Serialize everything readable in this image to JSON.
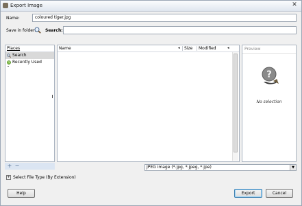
{
  "window": {
    "title": "Export Image",
    "close_symbol": "✕"
  },
  "form": {
    "name_label": "Name:",
    "name_value": "coloured tiger.jpg",
    "save_in_folder_label": "Save in folder:",
    "search_label": "Search:",
    "search_value": ""
  },
  "places": {
    "header": "Places",
    "items": [
      {
        "label": "Search",
        "icon": "magnifier-icon",
        "selected": true
      },
      {
        "label": "Recently Used",
        "icon": "clock-icon",
        "selected": false
      }
    ],
    "add_symbol": "+",
    "remove_symbol": "−"
  },
  "file_list": {
    "columns": {
      "name": "Name",
      "size": "Size",
      "modified": "Modified"
    },
    "rows": []
  },
  "preview": {
    "header": "Preview",
    "placeholder": "No selection"
  },
  "filetype": {
    "selected": "JPEG image (*.jpg, *.jpeg, *.jpe)"
  },
  "expander": {
    "label": "Select File Type (By Extension)"
  },
  "buttons": {
    "help": "Help",
    "export": "Export",
    "cancel": "Cancel"
  },
  "colors": {
    "accent": "#3c7fb1",
    "panel_border": "#a9b3c0",
    "window_bg": "#f0f0f0"
  }
}
